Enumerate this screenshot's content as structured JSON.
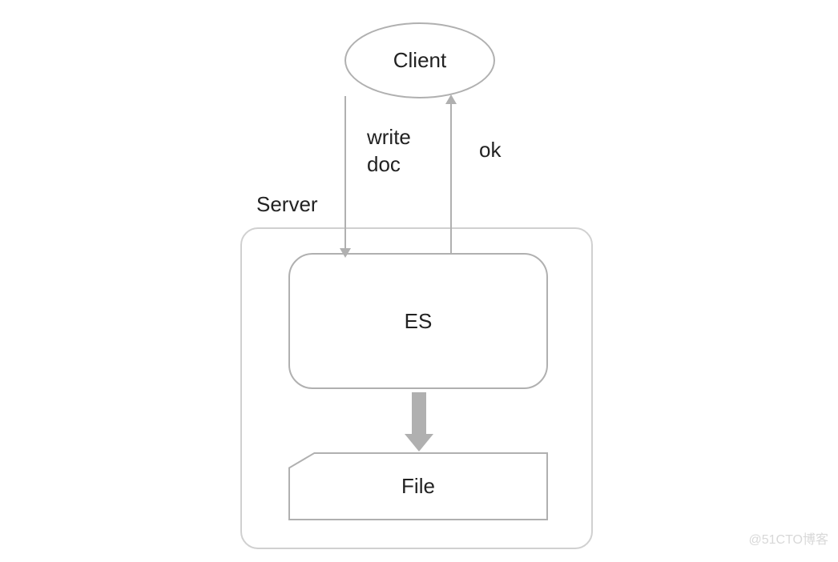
{
  "nodes": {
    "client": "Client",
    "server": "Server",
    "es": "ES",
    "file": "File"
  },
  "edges": {
    "write_line1": "write",
    "write_line2": "doc",
    "ok": "ok"
  },
  "watermark": "@51CTO博客"
}
